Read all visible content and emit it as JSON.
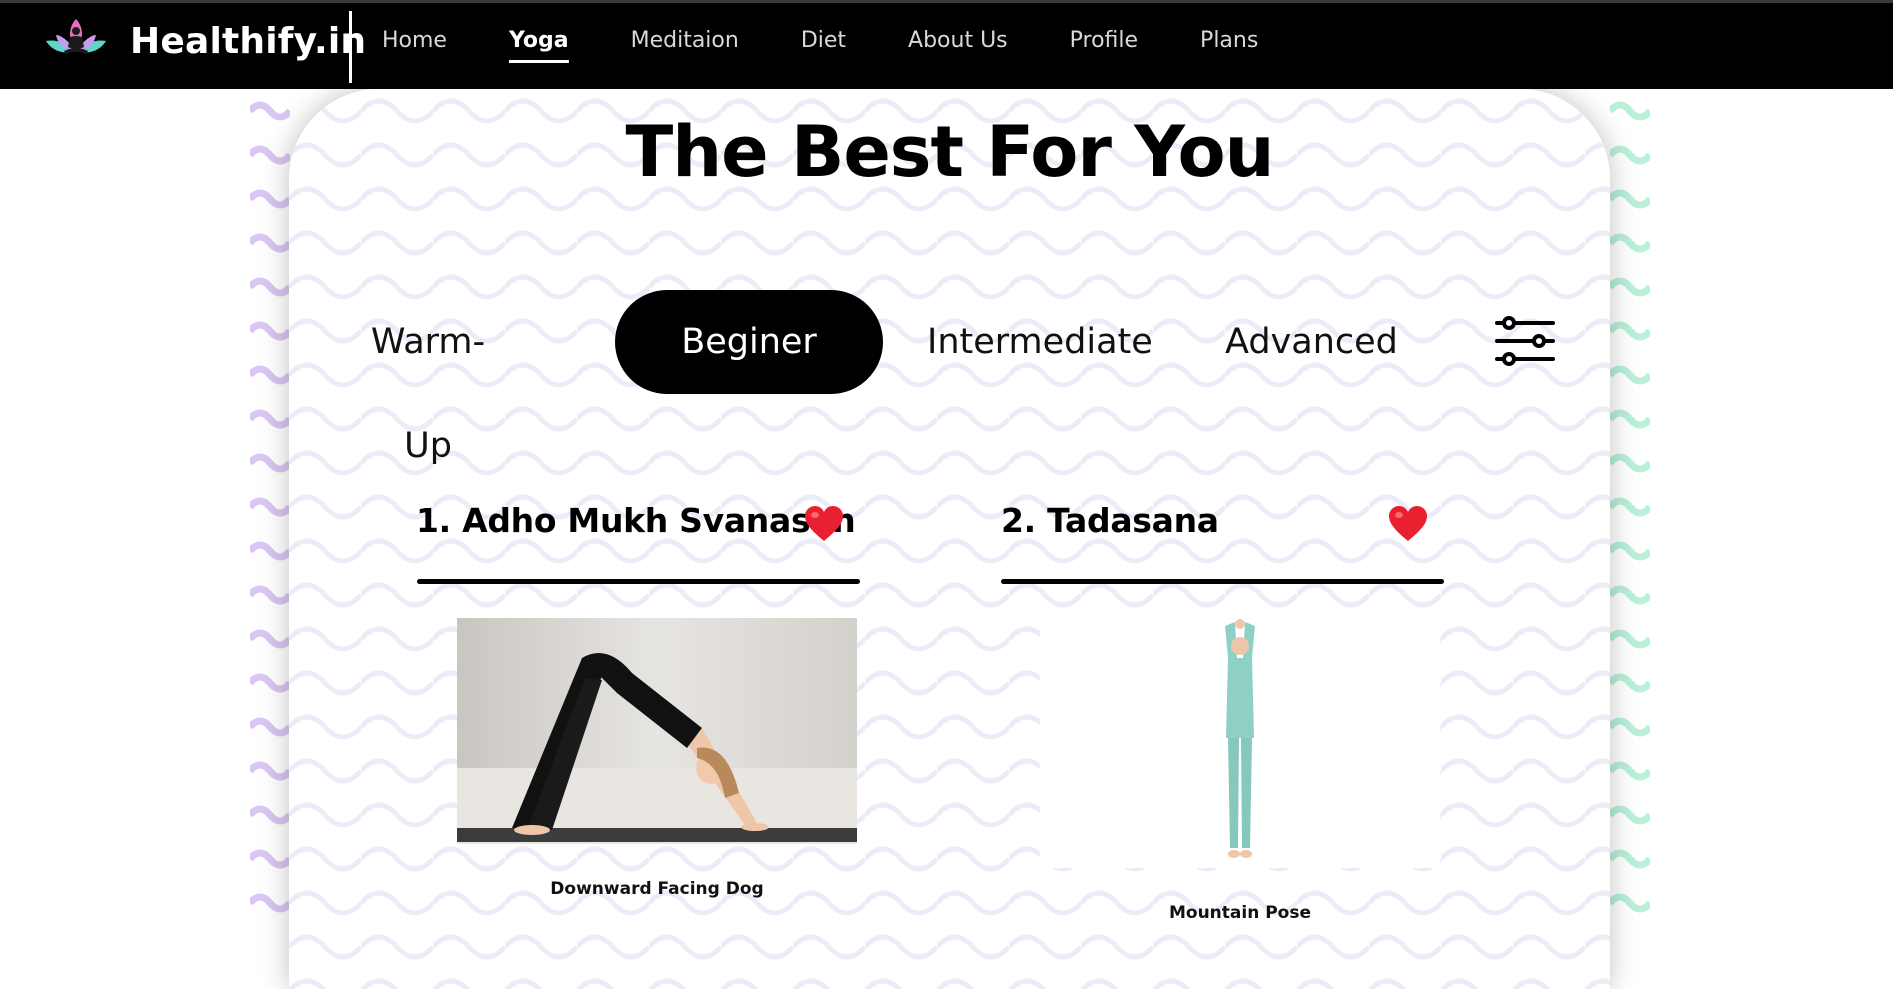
{
  "brand": {
    "name": "Healthify.in"
  },
  "nav": {
    "items": [
      {
        "label": "Home",
        "active": false
      },
      {
        "label": "Yoga",
        "active": true
      },
      {
        "label": "Meditaion",
        "active": false
      },
      {
        "label": "Diet",
        "active": false
      },
      {
        "label": "About Us",
        "active": false
      },
      {
        "label": "Profile",
        "active": false
      },
      {
        "label": "Plans",
        "active": false
      }
    ]
  },
  "main": {
    "title": "The Best For You",
    "levels": [
      {
        "label": "Warm-Up",
        "active": false
      },
      {
        "label": "Beginer",
        "active": true
      },
      {
        "label": "Intermediate",
        "active": false
      },
      {
        "label": "Advanced",
        "active": false
      }
    ],
    "filter_icon": "sliders-icon",
    "poses": [
      {
        "heading": "1. Adho Mukh Svanasan",
        "caption": "Downward Facing Dog",
        "favorite_icon": "heart-icon"
      },
      {
        "heading": "2. Tadasana",
        "caption": "Mountain Pose",
        "favorite_icon": "heart-icon"
      }
    ]
  },
  "colors": {
    "nav_bg": "#000000",
    "accent_active": "#000000",
    "heart": "#e8202f",
    "wave_purple": "#d9c6f2",
    "wave_green": "#b8f0d8"
  }
}
